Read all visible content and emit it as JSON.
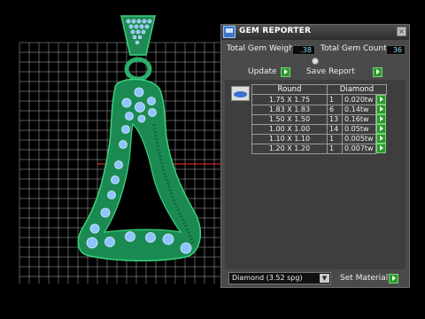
{
  "panel": {
    "title": "GEM REPORTER",
    "close_glyph": "×",
    "total_weight_label": "Total Gem Weight",
    "total_weight_value": ".38",
    "total_count_label": "Total Gem Count",
    "total_count_value": "36",
    "update_label": "Update",
    "save_report_label": "Save Report",
    "table": {
      "headers": [
        "Round",
        "Diamond"
      ],
      "rows": [
        {
          "size": "1.75 X 1.75",
          "count": "1",
          "weight": "0.020tw"
        },
        {
          "size": "1.83 X 1.83",
          "count": "6",
          "weight": "0.14tw"
        },
        {
          "size": "1.50 X 1.50",
          "count": "13",
          "weight": "0.16tw"
        },
        {
          "size": "1.00 X 1.00",
          "count": "14",
          "weight": "0.05tw"
        },
        {
          "size": "1.10 X 1.10",
          "count": "1",
          "weight": "0.005tw"
        },
        {
          "size": "1.20 X 1.20",
          "count": "1",
          "weight": "0.007tw"
        }
      ]
    },
    "gem_type_selected": "Diamond    (3.52 spg)",
    "set_material_label": "Set Material"
  },
  "icons": {
    "app": "gem-reporter-app-icon",
    "close": "close-icon",
    "go": "green-arrow-icon",
    "dropdown": "chevron-down-icon",
    "collapse": "collapse-icon",
    "gem_preview": "gem-preview-icon"
  },
  "colors": {
    "pendant_metal": "#1a9a5c",
    "gem_stone": "#8ec4ff",
    "grid_line": "#bfbfbf",
    "axis_red": "#ff3030",
    "axis_cyan": "#00d0d0",
    "panel_bg": "#4a4a4a"
  }
}
